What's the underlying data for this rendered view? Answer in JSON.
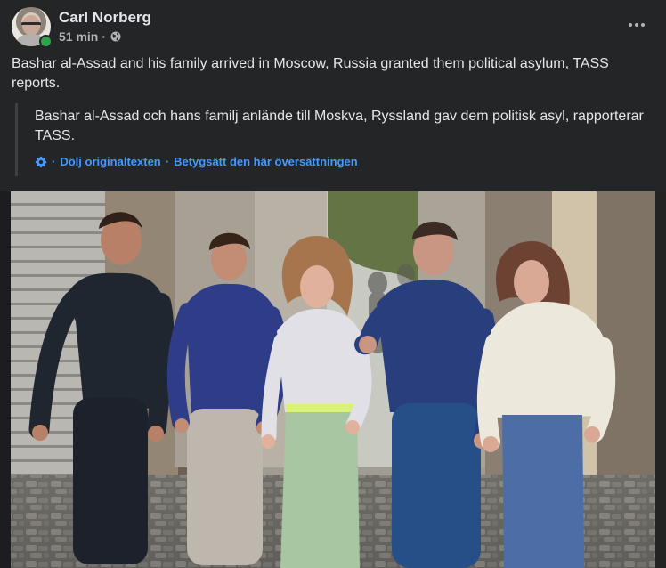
{
  "post": {
    "author": "Carl Norberg",
    "time": "51 min",
    "separator": "·",
    "privacy_icon": "globe-icon",
    "more_icon": "more-options-icon",
    "text": "Bashar al-Assad and his family arrived in Moscow, Russia granted them political asylum, TASS reports.",
    "original_text": "Bashar al-Assad och hans familj anlände till Moskva, Ryssland gav dem politisk asyl, rapporterar TASS.",
    "translation_settings_icon": "gear-icon",
    "hide_original_label": "Dölj originaltexten",
    "rate_translation_label": "Betygsätt den här översättningen"
  },
  "colors": {
    "background": "#242526",
    "primary_text": "#e4e6eb",
    "secondary_text": "#b0b3b8",
    "link": "#4599ff",
    "online": "#31a24c"
  }
}
